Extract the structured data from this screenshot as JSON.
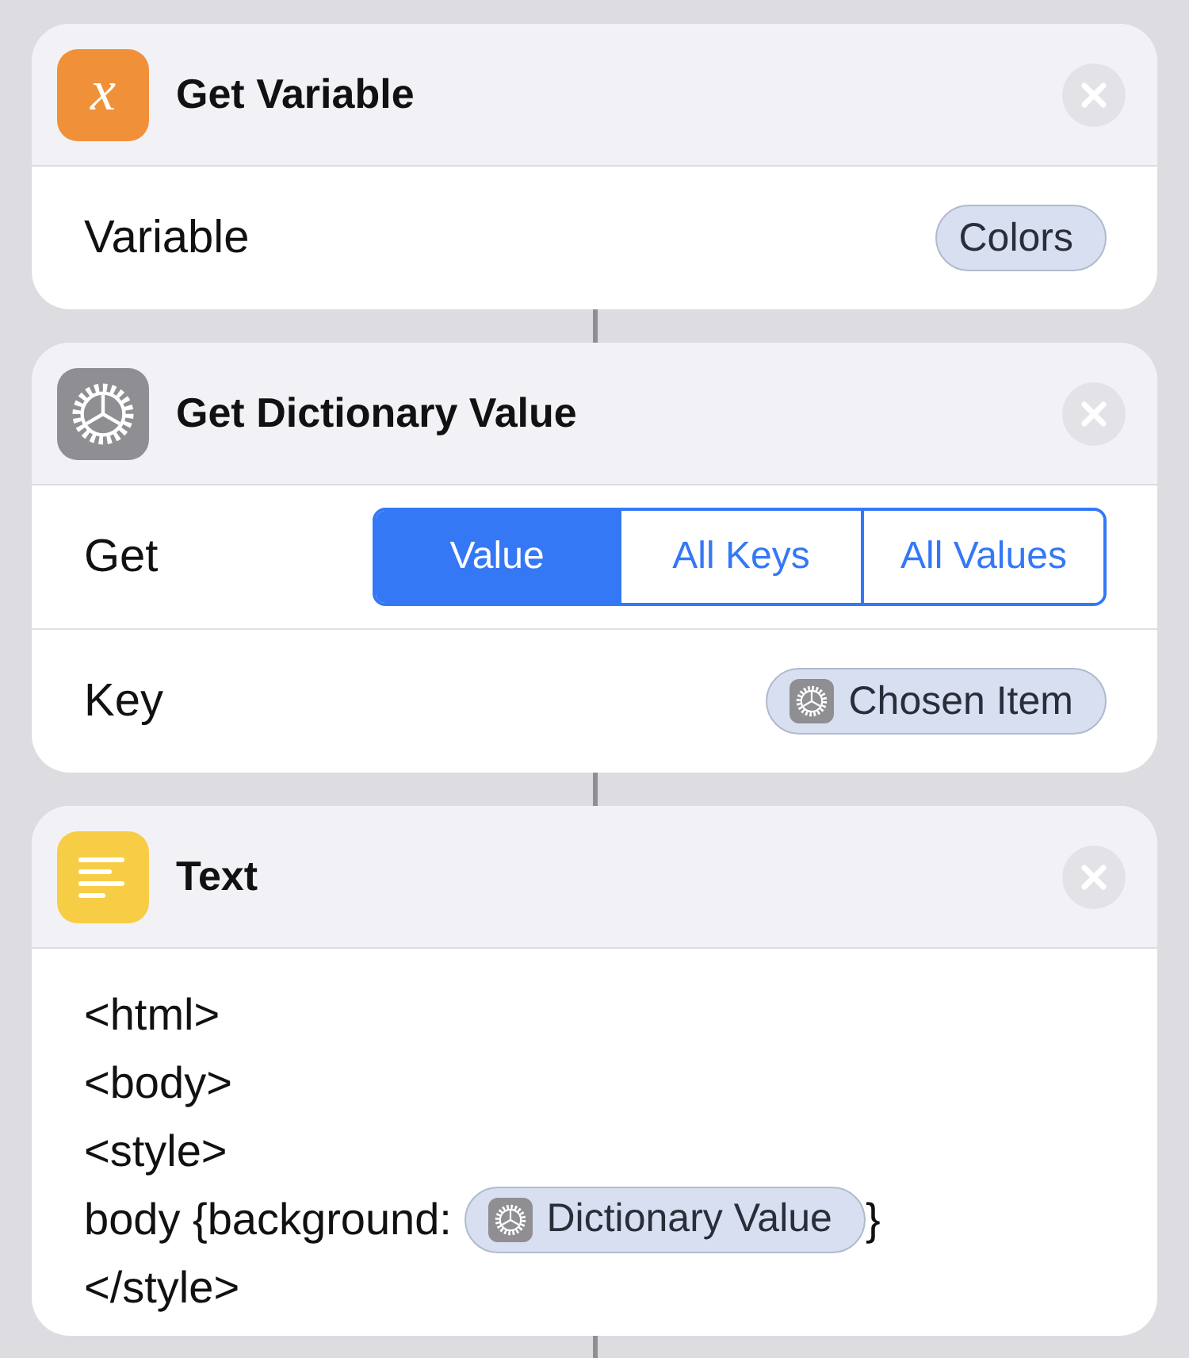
{
  "actions": [
    {
      "kind": "variable",
      "title": "Get Variable",
      "glyph": "x",
      "rows": [
        {
          "kind": "token",
          "label": "Variable",
          "token": {
            "text": "Colors",
            "icon": false
          }
        }
      ]
    },
    {
      "kind": "gear",
      "title": "Get Dictionary Value",
      "rows": [
        {
          "kind": "segmented",
          "label": "Get",
          "segments": [
            {
              "label": "Value",
              "selected": true
            },
            {
              "label": "All Keys",
              "selected": false
            },
            {
              "label": "All Values",
              "selected": false
            }
          ]
        },
        {
          "kind": "token",
          "label": "Key",
          "token": {
            "text": "Chosen Item",
            "icon": true
          }
        }
      ]
    },
    {
      "kind": "text",
      "title": "Text",
      "lines": [
        {
          "text": "<html>"
        },
        {
          "text": "<body>"
        },
        {
          "text": "<style>"
        },
        {
          "text": "body {background: ",
          "token": {
            "text": "Dictionary Value",
            "icon": true
          },
          "after": "}"
        },
        {
          "text": "</style>"
        }
      ]
    }
  ]
}
